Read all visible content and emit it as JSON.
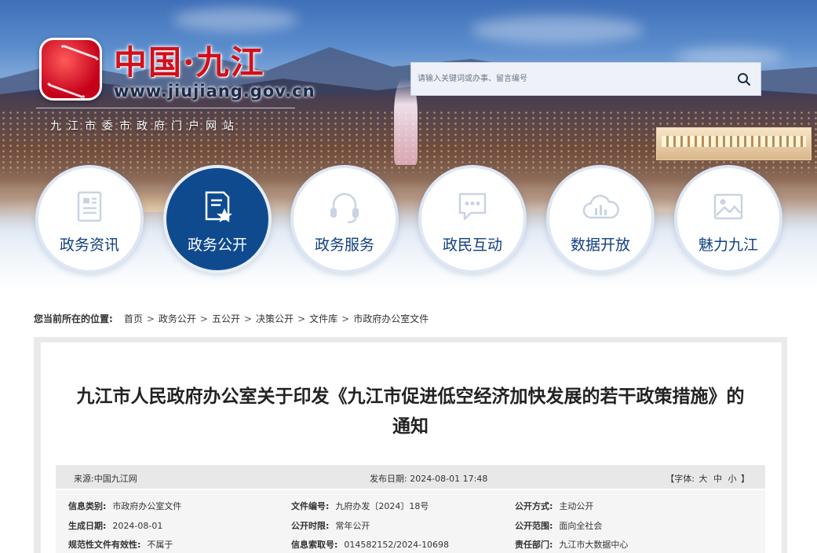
{
  "header": {
    "title": "中国·九江",
    "url": "www.jiujiang.gov.cn",
    "subtitle": "九江市委市政府门户网站",
    "search": {
      "placeholder": "请输入关键词或办事、留言编号"
    }
  },
  "nav": {
    "items": [
      {
        "label": "政务资讯",
        "icon": "newspaper-icon",
        "active": false
      },
      {
        "label": "政务公开",
        "icon": "document-star-icon",
        "active": true
      },
      {
        "label": "政务服务",
        "icon": "headset-icon",
        "active": false
      },
      {
        "label": "政民互动",
        "icon": "chat-bubble-icon",
        "active": false
      },
      {
        "label": "数据开放",
        "icon": "cloud-chart-icon",
        "active": false
      },
      {
        "label": "魅力九江",
        "icon": "picture-icon",
        "active": false
      }
    ]
  },
  "breadcrumb": {
    "prefix": "您当前所在的位置:",
    "items": [
      "首页",
      "政务公开",
      "五公开",
      "决策公开",
      "文件库",
      "市政府办公室文件"
    ]
  },
  "article": {
    "title_line1": "九江市人民政府办公室关于印发《九江市促进低空经济加快发展的若干政策措施》的",
    "title_line2": "通知",
    "source": "来源:中国九江网",
    "publish_date": "发布日期: 2024-08-01 17:48",
    "font_size": {
      "prefix": "【字体:",
      "options": [
        "大",
        "中",
        "小"
      ],
      "suffix": "】"
    },
    "meta": {
      "row1": [
        {
          "key": "信息类别:",
          "value": "市政府办公室文件"
        },
        {
          "key": "文件编号:",
          "value": "九府办发〔2024〕18号"
        },
        {
          "key": "公开方式:",
          "value": "主动公开"
        }
      ],
      "row2": [
        {
          "key": "生成日期:",
          "value": "2024-08-01"
        },
        {
          "key": "公开时限:",
          "value": "常年公开"
        },
        {
          "key": "公开范围:",
          "value": "面向全社会"
        }
      ],
      "row3": [
        {
          "key": "规范性文件有效性:",
          "value": "不属于"
        },
        {
          "key": "信息索取号:",
          "value": "014582152/2024-10698"
        },
        {
          "key": "责任部门:",
          "value": "九江市大数据中心"
        }
      ]
    }
  },
  "colors": {
    "brand_red": "#d0101c",
    "nav_blue": "#0f4a8f",
    "nav_text": "#0f3f80"
  }
}
